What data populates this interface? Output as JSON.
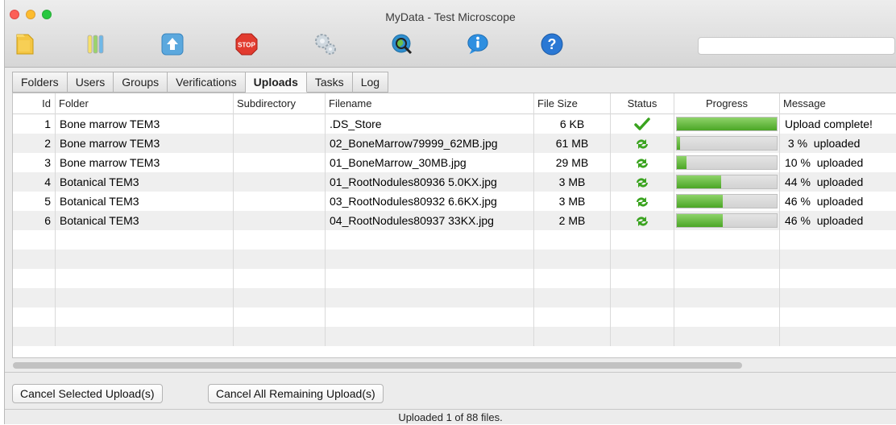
{
  "window": {
    "title": "MyData - Test Microscope"
  },
  "toolbar": {
    "icons": [
      "folder-icon",
      "test-tubes-icon",
      "upload-icon",
      "stop-icon",
      "settings-icon",
      "globe-search-icon",
      "info-icon",
      "help-icon"
    ],
    "stop_label": "STOP",
    "search_placeholder": ""
  },
  "tabs": [
    {
      "label": "Folders",
      "active": false
    },
    {
      "label": "Users",
      "active": false
    },
    {
      "label": "Groups",
      "active": false
    },
    {
      "label": "Verifications",
      "active": false
    },
    {
      "label": "Uploads",
      "active": true
    },
    {
      "label": "Tasks",
      "active": false
    },
    {
      "label": "Log",
      "active": false
    }
  ],
  "table": {
    "columns": [
      "Id",
      "Folder",
      "Subdirectory",
      "Filename",
      "File Size",
      "Status",
      "Progress",
      "Message"
    ],
    "rows": [
      {
        "id": "1",
        "folder": "Bone marrow TEM3",
        "subdirectory": "",
        "filename": ".DS_Store",
        "size": "6 KB",
        "status": "complete",
        "progress": 100,
        "message": "Upload complete!"
      },
      {
        "id": "2",
        "folder": "Bone marrow TEM3",
        "subdirectory": "",
        "filename": "02_BoneMarrow79999_62MB.jpg",
        "size": "61 MB",
        "status": "uploading",
        "progress": 3,
        "message": " 3 %  uploaded"
      },
      {
        "id": "3",
        "folder": "Bone marrow TEM3",
        "subdirectory": "",
        "filename": "01_BoneMarrow_30MB.jpg",
        "size": "29 MB",
        "status": "uploading",
        "progress": 10,
        "message": "10 %  uploaded"
      },
      {
        "id": "4",
        "folder": "Botanical TEM3",
        "subdirectory": "",
        "filename": "01_RootNodules80936 5.0KX.jpg",
        "size": "3 MB",
        "status": "uploading",
        "progress": 44,
        "message": "44 %  uploaded"
      },
      {
        "id": "5",
        "folder": "Botanical TEM3",
        "subdirectory": "",
        "filename": "03_RootNodules80932 6.6KX.jpg",
        "size": "3 MB",
        "status": "uploading",
        "progress": 46,
        "message": "46 %  uploaded"
      },
      {
        "id": "6",
        "folder": "Botanical TEM3",
        "subdirectory": "",
        "filename": "04_RootNodules80937 33KX.jpg",
        "size": "2 MB",
        "status": "uploading",
        "progress": 46,
        "message": "46 %  uploaded"
      }
    ]
  },
  "buttons": {
    "cancel_selected": "Cancel Selected Upload(s)",
    "cancel_all": "Cancel All Remaining Upload(s)"
  },
  "statusbar": {
    "text": "Uploaded 1 of 88 files."
  },
  "colors": {
    "progress_fill": "#5cb83a",
    "status_green": "#3aa31f"
  }
}
